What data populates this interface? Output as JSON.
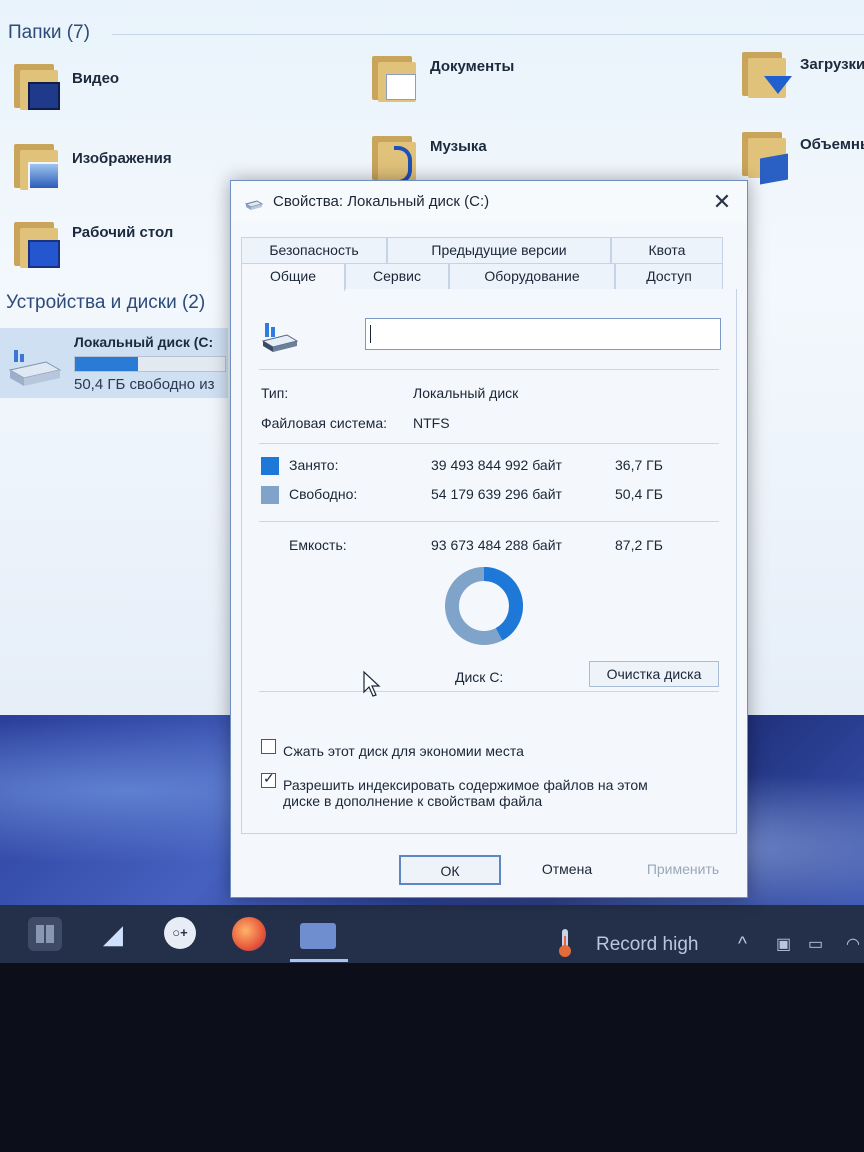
{
  "explorer": {
    "folders_header": "Папки (7)",
    "folders": [
      {
        "label": "Видео",
        "icon": "video-folder-icon"
      },
      {
        "label": "Документы",
        "icon": "documents-folder-icon"
      },
      {
        "label": "Загрузки",
        "icon": "downloads-folder-icon"
      },
      {
        "label": "Изображения",
        "icon": "pictures-folder-icon"
      },
      {
        "label": "Музыка",
        "icon": "music-folder-icon"
      },
      {
        "label": "Объемные",
        "icon": "3d-objects-folder-icon"
      },
      {
        "label": "Рабочий стол",
        "icon": "desktop-folder-icon"
      }
    ],
    "devices_header": "Устройства и диски (2)",
    "drive": {
      "name": "Локальный диск (C:",
      "free_text": "50,4 ГБ свободно из",
      "used_fraction": 0.42
    }
  },
  "dialog": {
    "title": "Свойства: Локальный диск (C:)",
    "tabs_row1": [
      "Безопасность",
      "Предыдущие версии",
      "Квота"
    ],
    "tabs_row2": [
      "Общие",
      "Сервис",
      "Оборудование",
      "Доступ"
    ],
    "active_tab": "Общие",
    "name_value": "",
    "type_label": "Тип:",
    "type_value": "Локальный диск",
    "fs_label": "Файловая система:",
    "fs_value": "NTFS",
    "used_label": "Занято:",
    "used_bytes": "39 493 844 992 байт",
    "used_gb": "36,7 ГБ",
    "free_label": "Свободно:",
    "free_bytes": "54 179 639 296 байт",
    "free_gb": "50,4 ГБ",
    "capacity_label": "Емкость:",
    "capacity_bytes": "93 673 484 288 байт",
    "capacity_gb": "87,2 ГБ",
    "disk_label": "Диск С:",
    "cleanup_button": "Очистка диска",
    "compress_label": "Сжать этот диск для экономии места",
    "compress_checked": false,
    "index_label_line1": "Разрешить индексировать содержимое файлов на этом",
    "index_label_line2": "диске в дополнение к свойствам файла",
    "index_checked": true,
    "ok": "ОК",
    "cancel": "Отмена",
    "apply": "Применить",
    "colors": {
      "used": "#1e78d8",
      "free": "#7fa3c9"
    }
  },
  "taskbar": {
    "weather_text": "Record high",
    "weather_icon": "thermometer-icon",
    "tray_chevron": "^"
  }
}
